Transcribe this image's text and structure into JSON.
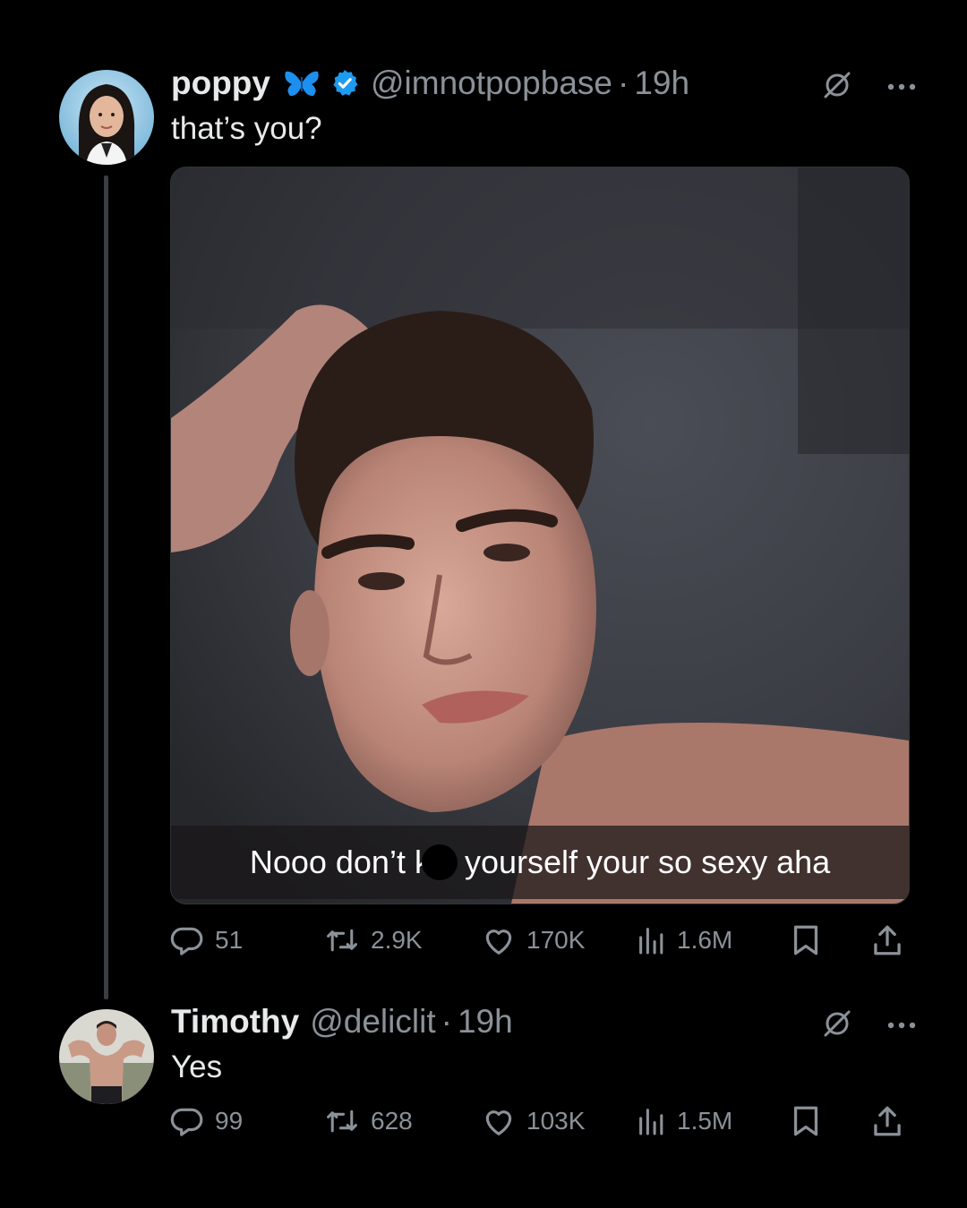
{
  "tweet1": {
    "name": "poppy",
    "name_emoji": "butterfly-emoji",
    "verified": true,
    "handle": "@imnotpopbase",
    "separator": "·",
    "time": "19h",
    "text": "that’s you?",
    "media_caption_before": "Nooo don’t k",
    "media_caption_after": "yourself your so sexy aha",
    "stats": {
      "replies": "51",
      "reposts": "2.9K",
      "likes": "170K",
      "views": "1.6M"
    }
  },
  "tweet2": {
    "name": "Timothy",
    "handle": "@deliclit",
    "separator": "·",
    "time": "19h",
    "text": "Yes",
    "stats": {
      "replies": "99",
      "reposts": "628",
      "likes": "103K",
      "views": "1.5M"
    }
  },
  "colors": {
    "background": "#000000",
    "primary_text": "#e7e9ea",
    "secondary_text": "#8b9198",
    "verified_blue": "#1d9bf0",
    "butterfly_blue": "#1d8ff0"
  },
  "icons": [
    "grok-icon",
    "more-icon",
    "reply-icon",
    "repost-icon",
    "like-icon",
    "views-icon",
    "bookmark-icon",
    "share-icon",
    "verified-badge-icon",
    "butterfly-emoji-icon"
  ]
}
